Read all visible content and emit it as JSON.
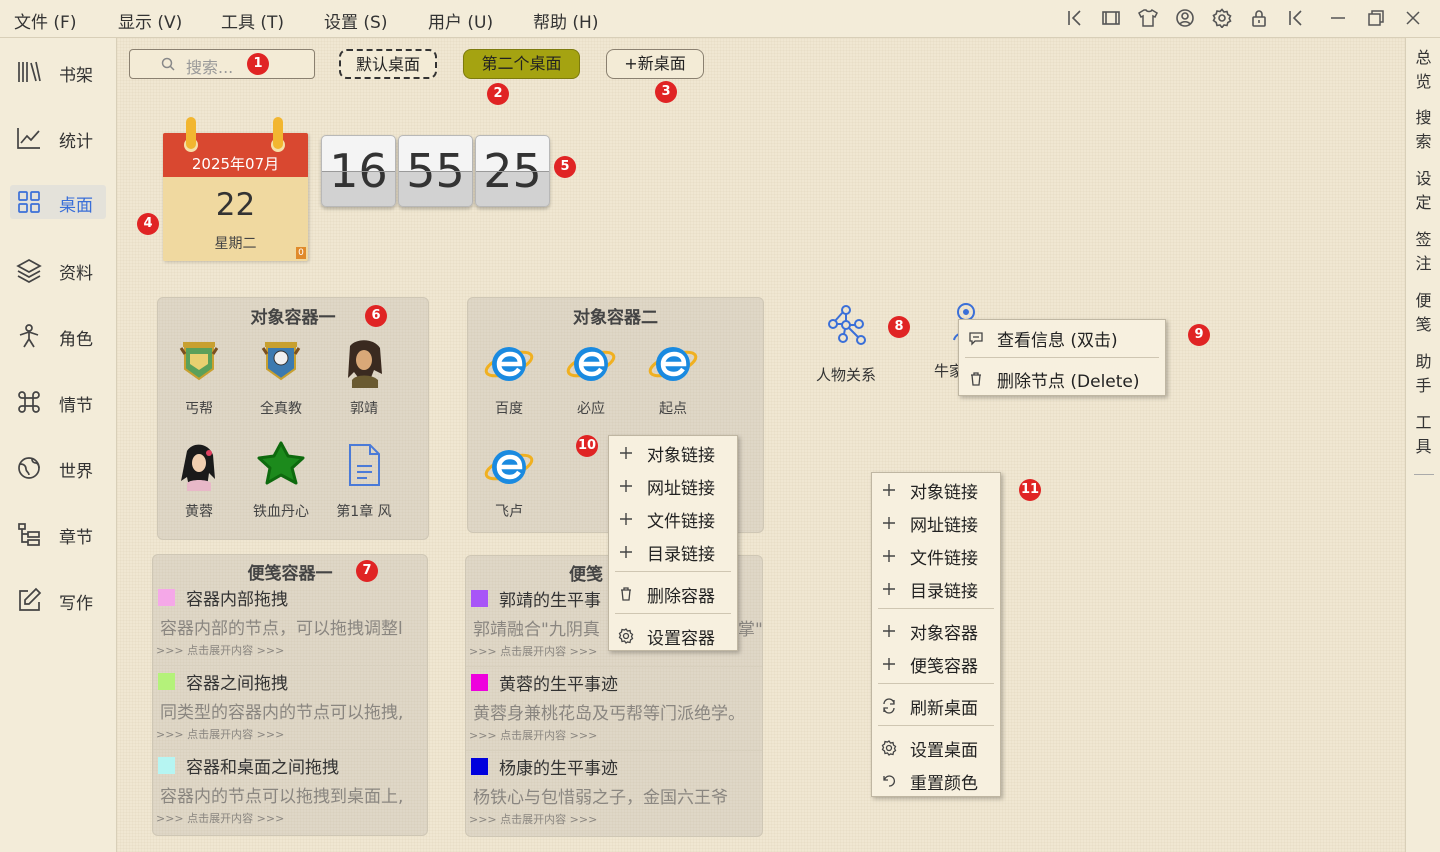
{
  "menubar": {
    "items": [
      "文件 (F)",
      "显示 (V)",
      "工具 (T)",
      "设置 (S)",
      "用户 (U)",
      "帮助 (H)"
    ],
    "toolbar_icons": [
      "collapse-left-icon",
      "fullscreen-icon",
      "theme-shirt-icon",
      "user-circle-icon",
      "settings-gear-icon",
      "lock-icon",
      "collapse-left-2-icon",
      "minimize-icon",
      "restore-icon",
      "close-icon"
    ]
  },
  "leftnav": {
    "items": [
      {
        "label": "书架",
        "icon": "bookshelf-icon"
      },
      {
        "label": "统计",
        "icon": "chart-line-icon"
      },
      {
        "label": "桌面",
        "icon": "grid-icon",
        "active": true
      },
      {
        "label": "资料",
        "icon": "layers-icon"
      },
      {
        "label": "角色",
        "icon": "person-icon"
      },
      {
        "label": "情节",
        "icon": "command-icon"
      },
      {
        "label": "世界",
        "icon": "globe-icon"
      },
      {
        "label": "章节",
        "icon": "outline-icon"
      },
      {
        "label": "写作",
        "icon": "edit-icon"
      }
    ]
  },
  "rightbar": {
    "items": [
      "总览",
      "搜索",
      "设定",
      "签注",
      "便笺",
      "助手",
      "工具"
    ]
  },
  "desk": {
    "search_placeholder": "搜索...",
    "tabs": {
      "default": "默认桌面",
      "second": "第二个桌面",
      "new": "+新桌面"
    },
    "badges": [
      "1",
      "2",
      "3",
      "4",
      "5",
      "6",
      "7",
      "8",
      "9",
      "10",
      "11"
    ],
    "calendar": {
      "year_month": "2025年07月",
      "day": "22",
      "weekday": "星期二",
      "mini": "0"
    },
    "clock": {
      "hh": "16",
      "mm": "55",
      "ss": "25"
    },
    "container1": {
      "title": "对象容器一",
      "items": [
        "丐帮",
        "全真教",
        "郭靖",
        "黄蓉",
        "铁血丹心",
        "第1章 风"
      ]
    },
    "container2": {
      "title": "对象容器二",
      "items": [
        "百度",
        "必应",
        "起点",
        "飞卢"
      ]
    },
    "note1": {
      "title": "便笺容器一",
      "rows": [
        {
          "title": "容器内部拖拽",
          "text": "容器内部的节点，可以拖拽调整l",
          "more": ">>> 点击展开内容 >>>",
          "color": "#f5a8e8"
        },
        {
          "title": "容器之间拖拽",
          "text": "同类型的容器内的节点可以拖拽,",
          "more": ">>> 点击展开内容 >>>",
          "color": "#b4f27a"
        },
        {
          "title": "容器和桌面之间拖拽",
          "text": "容器内的节点可以拖拽到桌面上,",
          "more": ">>> 点击展开内容 >>>",
          "color": "#b6f5f2"
        }
      ]
    },
    "note2": {
      "title": "便笺",
      "rows": [
        {
          "title": "郭靖的生平事",
          "text": "郭靖融合\"九阴真",
          "text_tail": "掌\"",
          "more": ">>> 点击展开内容 >>>",
          "color": "#a855f7"
        },
        {
          "title": "黄蓉的生平事迹",
          "text": "黄蓉身兼桃花岛及丐帮等门派绝学。",
          "more": ">>> 点击展开内容 >>>",
          "color": "#ee00dd"
        },
        {
          "title": "杨康的生平事迹",
          "text": "杨铁心与包惜弱之子，金国六王爷",
          "more": ">>> 点击展开内容 >>>",
          "color": "#0000dd"
        }
      ]
    },
    "desk_icons": [
      {
        "label": "人物关系",
        "icon": "network-graph-icon"
      },
      {
        "label": "牛家",
        "icon": "user-node-icon"
      }
    ],
    "node_menu": {
      "items": [
        "查看信息 (双击)",
        "删除节点 (Delete)"
      ]
    },
    "container_menu": {
      "items": [
        "对象链接",
        "网址链接",
        "文件链接",
        "目录链接",
        "删除容器",
        "设置容器"
      ]
    },
    "desk_menu": {
      "items": [
        "对象链接",
        "网址链接",
        "文件链接",
        "目录链接",
        "对象容器",
        "便笺容器",
        "刷新桌面",
        "设置桌面",
        "重置颜色"
      ]
    }
  }
}
